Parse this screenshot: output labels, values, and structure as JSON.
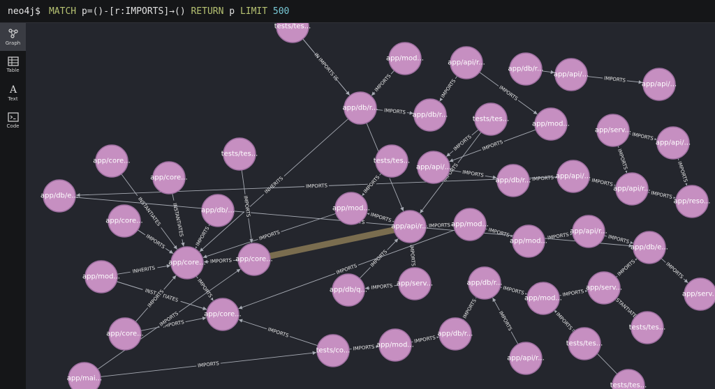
{
  "command_bar": {
    "prompt": "neo4j$",
    "kw_match": "MATCH",
    "pattern": "p=()-[r:IMPORTS]→()",
    "kw_return": "RETURN",
    "return_var": "p",
    "kw_limit": "LIMIT",
    "limit_value": "500"
  },
  "sidebar": {
    "items": [
      {
        "label": "Graph",
        "icon": "graph-icon",
        "active": true
      },
      {
        "label": "Table",
        "icon": "table-icon",
        "active": false
      },
      {
        "label": "Text",
        "icon": "text-icon",
        "active": false
      },
      {
        "label": "Code",
        "icon": "code-icon",
        "active": false
      }
    ]
  },
  "graph": {
    "colors": {
      "node_fill": "#c68fc1",
      "edge": "#a7abb4",
      "highlight_edge": "#8a7a55"
    },
    "nodes": [
      {
        "id": "n1",
        "label": "tests/tes..."
      },
      {
        "id": "n2",
        "label": "app/mod..."
      },
      {
        "id": "n3",
        "label": "app/api/r..."
      },
      {
        "id": "n4",
        "label": "app/db/r..."
      },
      {
        "id": "n5",
        "label": "app/api/..."
      },
      {
        "id": "n6",
        "label": "app/api/..."
      },
      {
        "id": "n7",
        "label": "app/db/r..."
      },
      {
        "id": "n8",
        "label": "app/db/r..."
      },
      {
        "id": "n9",
        "label": "tests/tes..."
      },
      {
        "id": "n10",
        "label": "app/mod..."
      },
      {
        "id": "n11",
        "label": "app/serv..."
      },
      {
        "id": "n12",
        "label": "app/api/..."
      },
      {
        "id": "n13",
        "label": "app/core..."
      },
      {
        "id": "n14",
        "label": "tests/tes..."
      },
      {
        "id": "n15",
        "label": "app/core..."
      },
      {
        "id": "n16",
        "label": "tests/tes..."
      },
      {
        "id": "n17",
        "label": "app/api/..."
      },
      {
        "id": "n18",
        "label": "app/db/r..."
      },
      {
        "id": "n19",
        "label": "app/api/..."
      },
      {
        "id": "n20",
        "label": "app/api/r..."
      },
      {
        "id": "n21",
        "label": "app/reso..."
      },
      {
        "id": "n22",
        "label": "app/db/e..."
      },
      {
        "id": "n23",
        "label": "app/db/..."
      },
      {
        "id": "n24",
        "label": "app/mod..."
      },
      {
        "id": "n25",
        "label": "app/core..."
      },
      {
        "id": "n26",
        "label": "app/api/r..."
      },
      {
        "id": "n27",
        "label": "app/mod..."
      },
      {
        "id": "n28",
        "label": "app/api/r..."
      },
      {
        "id": "n29",
        "label": "app/mod..."
      },
      {
        "id": "n30",
        "label": "app/db/e..."
      },
      {
        "id": "n31",
        "label": "app/core..."
      },
      {
        "id": "n32",
        "label": "app/core..."
      },
      {
        "id": "n33",
        "label": "app/mod..."
      },
      {
        "id": "n34",
        "label": "app/db/q..."
      },
      {
        "id": "n35",
        "label": "app/serv..."
      },
      {
        "id": "n36",
        "label": "app/db/r..."
      },
      {
        "id": "n37",
        "label": "app/mod..."
      },
      {
        "id": "n38",
        "label": "app/serv..."
      },
      {
        "id": "n39",
        "label": "app/serv..."
      },
      {
        "id": "n40",
        "label": "app/core..."
      },
      {
        "id": "n41",
        "label": "app/core..."
      },
      {
        "id": "n42",
        "label": "app/db/r..."
      },
      {
        "id": "n43",
        "label": "app/mod..."
      },
      {
        "id": "n44",
        "label": "tests/co..."
      },
      {
        "id": "n45",
        "label": "tests/tes..."
      },
      {
        "id": "n46",
        "label": "tests/tes..."
      },
      {
        "id": "n47",
        "label": "app/api/r..."
      },
      {
        "id": "n48",
        "label": "app/mai..."
      },
      {
        "id": "n49",
        "label": "tests/tes..."
      }
    ],
    "edges": [
      {
        "from": "n1",
        "to": "n7",
        "label": "INSTANTIATES"
      },
      {
        "from": "n1",
        "to": "n7",
        "label": "IMPORTS"
      },
      {
        "from": "n2",
        "to": "n7",
        "label": "IMPORTS"
      },
      {
        "from": "n7",
        "to": "n8",
        "label": "IMPORTS"
      },
      {
        "from": "n7",
        "to": "n26",
        "label": "IMPORTS"
      },
      {
        "from": "n7",
        "to": "n31",
        "label": "INHERITS"
      },
      {
        "from": "n9",
        "to": "n17",
        "label": "IMPORTS"
      },
      {
        "from": "n9",
        "to": "n26",
        "label": "IMPORTS"
      },
      {
        "from": "n3",
        "to": "n8",
        "label": "IMPORTS"
      },
      {
        "from": "n3",
        "to": "n10",
        "label": "IMPORTS"
      },
      {
        "from": "n4",
        "to": "n5",
        "label": "IMPORTS"
      },
      {
        "from": "n5",
        "to": "n6",
        "label": "IMPORTS"
      },
      {
        "from": "n11",
        "to": "n12",
        "label": "IMPORTS"
      },
      {
        "from": "n10",
        "to": "n17",
        "label": "IMPORTS"
      },
      {
        "from": "n17",
        "to": "n18",
        "label": "IMPORTS"
      },
      {
        "from": "n18",
        "to": "n19",
        "label": "IMPORTS"
      },
      {
        "from": "n19",
        "to": "n20",
        "label": "IMPORTS"
      },
      {
        "from": "n20",
        "to": "n21",
        "label": "IMPORTS"
      },
      {
        "from": "n19",
        "to": "n22",
        "label": "IMPORTS"
      },
      {
        "from": "n26",
        "to": "n27",
        "label": "IMPORTS"
      },
      {
        "from": "n27",
        "to": "n29",
        "label": "IMPORTS"
      },
      {
        "from": "n29",
        "to": "n28",
        "label": "IMPORTS"
      },
      {
        "from": "n28",
        "to": "n30",
        "label": "IMPORTS"
      },
      {
        "from": "n30",
        "to": "n39",
        "label": "IMPORTS"
      },
      {
        "from": "n26",
        "to": "n24",
        "label": "IMPORTS"
      },
      {
        "from": "n24",
        "to": "n31",
        "label": "IMPORTS"
      },
      {
        "from": "n23",
        "to": "n31",
        "label": "IMPORTS"
      },
      {
        "from": "n16",
        "to": "n24",
        "label": "IMPORTS"
      },
      {
        "from": "n13",
        "to": "n31",
        "label": "INSTANTIATES"
      },
      {
        "from": "n15",
        "to": "n31",
        "label": "INSTANTIATES"
      },
      {
        "from": "n25",
        "to": "n31",
        "label": "INHERITS"
      },
      {
        "from": "n25",
        "to": "n31",
        "label": "IMPORTS"
      },
      {
        "from": "n22",
        "to": "n30",
        "label": "IMPORTS"
      },
      {
        "from": "n14",
        "to": "n32",
        "label": "IMPORTS"
      },
      {
        "from": "n33",
        "to": "n31",
        "label": "INHERITS"
      },
      {
        "from": "n33",
        "to": "n40",
        "label": "IMPORTS"
      },
      {
        "from": "n33",
        "to": "n40",
        "label": "INSTANTIATES"
      },
      {
        "from": "n32",
        "to": "n31",
        "label": "IMPORTS"
      },
      {
        "from": "n31",
        "to": "n40",
        "label": "IMPORTS"
      },
      {
        "from": "n41",
        "to": "n31",
        "label": "IMPORTS"
      },
      {
        "from": "n41",
        "to": "n40",
        "label": "IMPORTS"
      },
      {
        "from": "n48",
        "to": "n32",
        "label": "IMPORTS"
      },
      {
        "from": "n48",
        "to": "n44",
        "label": "IMPORTS"
      },
      {
        "from": "n44",
        "to": "n40",
        "label": "IMPORTS"
      },
      {
        "from": "n44",
        "to": "n43",
        "label": "IMPORTS"
      },
      {
        "from": "n43",
        "to": "n42",
        "label": "IMPORTS"
      },
      {
        "from": "n42",
        "to": "n36",
        "label": "IMPORTS"
      },
      {
        "from": "n36",
        "to": "n37",
        "label": "IMPORTS"
      },
      {
        "from": "n37",
        "to": "n38",
        "label": "IMPORTS"
      },
      {
        "from": "n38",
        "to": "n30",
        "label": "IMPORTS"
      },
      {
        "from": "n38",
        "to": "n45",
        "label": "INSTANTIATES"
      },
      {
        "from": "n35",
        "to": "n26",
        "label": "IMPORTS"
      },
      {
        "from": "n35",
        "to": "n34",
        "label": "IMPORTS"
      },
      {
        "from": "n34",
        "to": "n26",
        "label": "IMPORTS"
      },
      {
        "from": "n47",
        "to": "n36",
        "label": "IMPORTS"
      },
      {
        "from": "n49",
        "to": "n37",
        "label": "IMPORTS"
      },
      {
        "from": "n46",
        "to": "n37",
        "label": "IMPORTS"
      },
      {
        "from": "n27",
        "to": "n40",
        "label": "IMPORTS"
      },
      {
        "from": "n11",
        "to": "n20",
        "label": "IMPORTS"
      },
      {
        "from": "n12",
        "to": "n21",
        "label": "IMPORTS"
      }
    ]
  }
}
